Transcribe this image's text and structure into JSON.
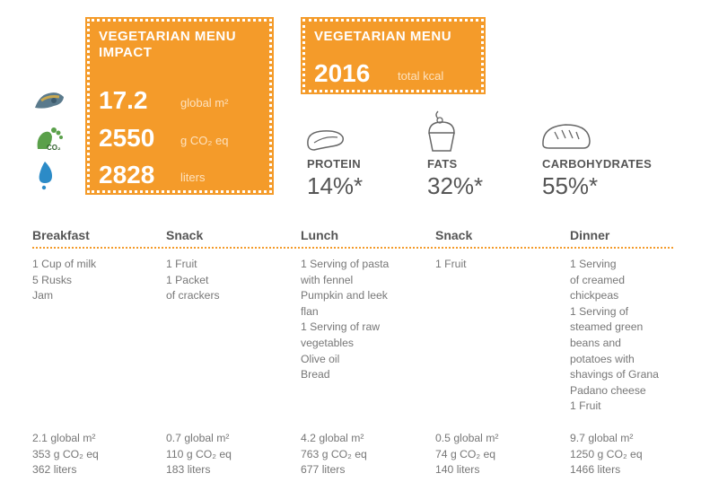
{
  "impact_box": {
    "title_line1": "VEGETARIAN MENU",
    "title_line2": "IMPACT",
    "rows": [
      {
        "value": "17.2",
        "unit": "global m²",
        "icon": "footprint-shoe-icon"
      },
      {
        "value": "2550",
        "unit": "g CO₂ eq",
        "icon": "co2-footprint-icon"
      },
      {
        "value": "2828",
        "unit": "liters",
        "icon": "water-drop-icon"
      }
    ]
  },
  "kcal_box": {
    "title": "VEGETARIAN MENU",
    "value": "2016",
    "unit": "total kcal"
  },
  "macros": [
    {
      "label": "PROTEIN",
      "value": "14%*",
      "icon": "steak-icon"
    },
    {
      "label": "FATS",
      "value": "32%*",
      "icon": "cupcake-icon"
    },
    {
      "label": "CARBOHYDRATES",
      "value": "55%*",
      "icon": "bread-icon"
    }
  ],
  "meals": [
    {
      "name": "Breakfast",
      "items": [
        "1 Cup of milk",
        "5 Rusks",
        "Jam"
      ],
      "footprint": [
        "2.1 global m²",
        "353 g CO₂ eq",
        "362 liters"
      ]
    },
    {
      "name": "Snack",
      "items": [
        "1 Fruit",
        "1 Packet",
        "of crackers"
      ],
      "footprint": [
        "0.7 global m²",
        "110 g CO₂ eq",
        "183 liters"
      ]
    },
    {
      "name": "Lunch",
      "items": [
        "1 Serving of pasta",
        "with fennel",
        "Pumpkin and leek",
        "flan",
        "1 Serving of raw",
        "vegetables",
        "Olive oil",
        "Bread"
      ],
      "footprint": [
        "4.2 global m²",
        "763 g CO₂ eq",
        "677 liters"
      ]
    },
    {
      "name": "Snack",
      "items": [
        "1 Fruit"
      ],
      "footprint": [
        "0.5 global m²",
        "74 g CO₂ eq",
        "140 liters"
      ]
    },
    {
      "name": "Dinner",
      "items": [
        "1 Serving",
        "of creamed",
        "chickpeas",
        "1 Serving of",
        "steamed green",
        "beans and",
        "potatoes with",
        "shavings of Grana",
        "Padano cheese",
        "1 Fruit"
      ],
      "footprint": [
        "9.7 global m²",
        "1250 g CO₂ eq",
        "1466 liters"
      ]
    }
  ],
  "colors": {
    "accent": "#f49b2a",
    "text": "#555555"
  }
}
